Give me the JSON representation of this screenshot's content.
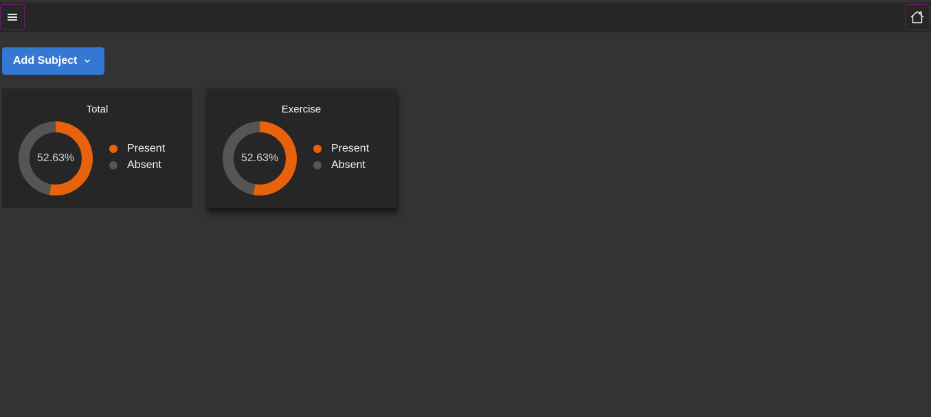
{
  "colors": {
    "present": "#e8620c",
    "absent": "#555555",
    "accent": "#3478d4"
  },
  "topbar": {
    "menu_icon": "hamburger-menu-icon",
    "home_icon": "home-icon"
  },
  "add_subject": {
    "label": "Add Subject",
    "icon": "chevron-down-icon"
  },
  "cards": [
    {
      "title": "Total",
      "percent_label": "52.63%",
      "present_fraction": 0.5263,
      "legend": [
        "Present",
        "Absent"
      ]
    },
    {
      "title": "Exercise",
      "percent_label": "52.63%",
      "present_fraction": 0.5263,
      "legend": [
        "Present",
        "Absent"
      ]
    }
  ]
}
